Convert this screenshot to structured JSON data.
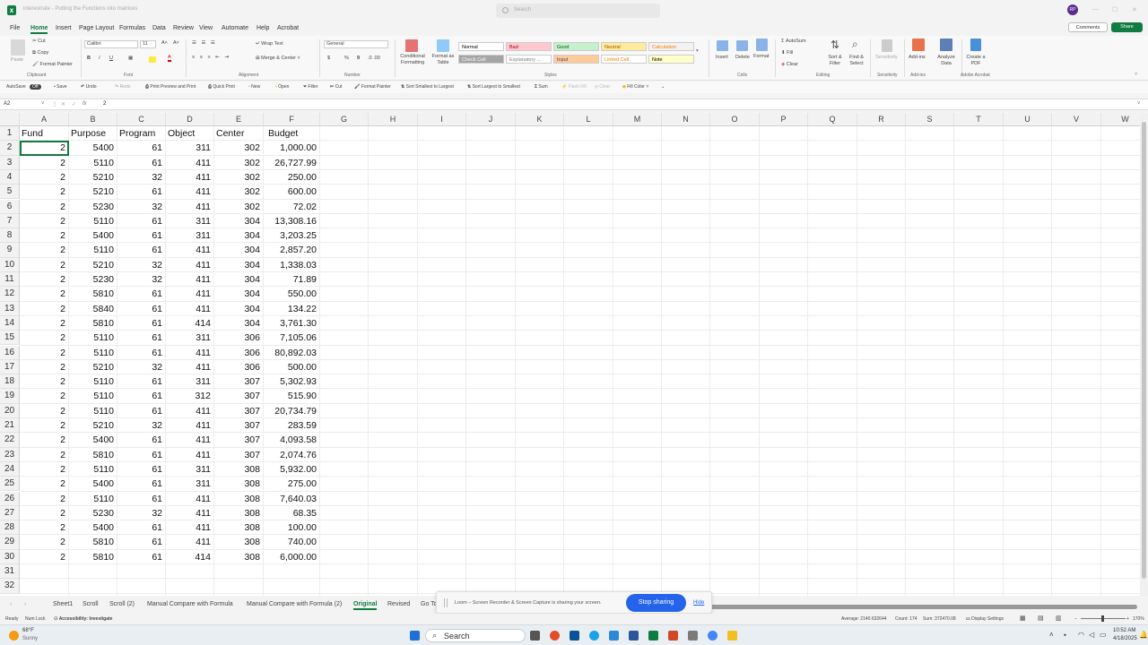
{
  "window": {
    "title": "interestrate - Putting the Functions into matrices",
    "search_placeholder": "Search",
    "avatar_initials": "RP",
    "comments_label": "Comments",
    "share_label": "Share"
  },
  "menu": [
    "File",
    "Home",
    "Insert",
    "Page Layout",
    "Formulas",
    "Data",
    "Review",
    "View",
    "Automate",
    "Help",
    "Acrobat"
  ],
  "menu_active": "Home",
  "ribbon": {
    "clipboard": {
      "paste": "Paste",
      "cut": "Cut",
      "copy": "Copy",
      "format_painter": "Format Painter",
      "group": "Clipboard"
    },
    "font": {
      "name": "Calibri",
      "size": "11",
      "group": "Font",
      "bold": "B",
      "italic": "I",
      "underline": "U"
    },
    "alignment": {
      "wrap": "Wrap Text",
      "merge": "Merge & Center",
      "group": "Alignment"
    },
    "number": {
      "format": "General",
      "group": "Number",
      "currency": "$",
      "percent": "%",
      "comma": "9"
    },
    "styles": {
      "conditional": "Conditional Formatting",
      "format_table": "Format as Table",
      "group": "Styles",
      "items": [
        {
          "label": "Normal",
          "bg": "#ffffff",
          "fg": "#000000"
        },
        {
          "label": "Bad",
          "bg": "#ffc7ce",
          "fg": "#9c0006"
        },
        {
          "label": "Good",
          "bg": "#c6efce",
          "fg": "#006100"
        },
        {
          "label": "Neutral",
          "bg": "#ffeb9c",
          "fg": "#9c5700"
        },
        {
          "label": "Calculation",
          "bg": "#f2f2f2",
          "fg": "#fa7d00"
        },
        {
          "label": "Check Cell",
          "bg": "#a5a5a5",
          "fg": "#ffffff"
        },
        {
          "label": "Explanatory ...",
          "bg": "#ffffff",
          "fg": "#7f7f7f"
        },
        {
          "label": "Input",
          "bg": "#ffcc99",
          "fg": "#3f3f76"
        },
        {
          "label": "Linked Cell",
          "bg": "#ffffff",
          "fg": "#fa7d00"
        },
        {
          "label": "Note",
          "bg": "#ffffcc",
          "fg": "#000000"
        }
      ]
    },
    "cells": {
      "insert": "Insert",
      "delete": "Delete",
      "format": "Format",
      "group": "Cells"
    },
    "editing": {
      "autosum": "AutoSum",
      "fill": "Fill",
      "clear": "Clear",
      "sort": "Sort & Filter",
      "find": "Find & Select",
      "group": "Editing"
    },
    "sensitivity": {
      "label": "Sensitivity",
      "group": "Sensitivity"
    },
    "addins": {
      "label": "Add-ins",
      "group": "Add-ins"
    },
    "analyze": {
      "label": "Analyze Data"
    },
    "pdf": {
      "label": "Create a PDF",
      "group": "Adobe Acrobat"
    }
  },
  "qat": {
    "autosave": "AutoSave",
    "autosave_state": "Off",
    "save": "Save",
    "undo": "Undo",
    "redo": "Redo",
    "print_preview": "Print Preview and Print",
    "quick_print": "Quick Print",
    "new": "New",
    "open": "Open",
    "filter": "Filter",
    "cut": "Cut",
    "format_painter": "Format Painter",
    "sort_asc": "Sort Smallest to Largest",
    "sort_desc": "Sort Largest to Smallest",
    "sum": "Sum",
    "flash_fill": "Flash Fill",
    "clear": "Clear",
    "fill_color": "Fill Color"
  },
  "formula_bar": {
    "name_box": "A2",
    "value": "2"
  },
  "columns": [
    "A",
    "B",
    "C",
    "D",
    "E",
    "F",
    "G",
    "H",
    "I",
    "J",
    "K",
    "L",
    "M",
    "N",
    "O",
    "P",
    "Q",
    "R",
    "S",
    "T",
    "U",
    "V",
    "W"
  ],
  "rows": [
    1,
    2,
    3,
    4,
    5,
    6,
    7,
    8,
    9,
    10,
    11,
    12,
    13,
    14,
    15,
    16,
    17,
    18,
    19,
    20,
    21,
    22,
    23,
    24,
    25,
    26,
    27,
    28,
    29,
    30,
    31,
    32
  ],
  "headers": [
    "Fund",
    "Purpose",
    "Program",
    "Object",
    "Center",
    "Budget"
  ],
  "table": [
    [
      "2",
      "5400",
      "61",
      "311",
      "302",
      "1,000.00"
    ],
    [
      "2",
      "5110",
      "61",
      "411",
      "302",
      "26,727.99"
    ],
    [
      "2",
      "5210",
      "32",
      "411",
      "302",
      "250.00"
    ],
    [
      "2",
      "5210",
      "61",
      "411",
      "302",
      "600.00"
    ],
    [
      "2",
      "5230",
      "32",
      "411",
      "302",
      "72.02"
    ],
    [
      "2",
      "5110",
      "61",
      "311",
      "304",
      "13,308.16"
    ],
    [
      "2",
      "5400",
      "61",
      "311",
      "304",
      "3,203.25"
    ],
    [
      "2",
      "5110",
      "61",
      "411",
      "304",
      "2,857.20"
    ],
    [
      "2",
      "5210",
      "32",
      "411",
      "304",
      "1,338.03"
    ],
    [
      "2",
      "5230",
      "32",
      "411",
      "304",
      "71.89"
    ],
    [
      "2",
      "5810",
      "61",
      "411",
      "304",
      "550.00"
    ],
    [
      "2",
      "5840",
      "61",
      "411",
      "304",
      "134.22"
    ],
    [
      "2",
      "5810",
      "61",
      "414",
      "304",
      "3,761.30"
    ],
    [
      "2",
      "5110",
      "61",
      "311",
      "306",
      "7,105.06"
    ],
    [
      "2",
      "5110",
      "61",
      "411",
      "306",
      "80,892.03"
    ],
    [
      "2",
      "5210",
      "32",
      "411",
      "306",
      "500.00"
    ],
    [
      "2",
      "5110",
      "61",
      "311",
      "307",
      "5,302.93"
    ],
    [
      "2",
      "5110",
      "61",
      "312",
      "307",
      "515.90"
    ],
    [
      "2",
      "5110",
      "61",
      "411",
      "307",
      "20,734.79"
    ],
    [
      "2",
      "5210",
      "32",
      "411",
      "307",
      "283.59"
    ],
    [
      "2",
      "5400",
      "61",
      "411",
      "307",
      "4,093.58"
    ],
    [
      "2",
      "5810",
      "61",
      "411",
      "307",
      "2,074.76"
    ],
    [
      "2",
      "5110",
      "61",
      "311",
      "308",
      "5,932.00"
    ],
    [
      "2",
      "5400",
      "61",
      "311",
      "308",
      "275.00"
    ],
    [
      "2",
      "5110",
      "61",
      "411",
      "308",
      "7,640.03"
    ],
    [
      "2",
      "5230",
      "32",
      "411",
      "308",
      "68.35"
    ],
    [
      "2",
      "5400",
      "61",
      "411",
      "308",
      "100.00"
    ],
    [
      "2",
      "5810",
      "61",
      "411",
      "308",
      "740.00"
    ],
    [
      "2",
      "5810",
      "61",
      "414",
      "308",
      "6,000.00"
    ]
  ],
  "sheets": [
    "Sheet1",
    "Scroll",
    "Scroll (2)",
    "Manual Compare with Formula",
    "Manual Compare with Formula (2)",
    "Original",
    "Revised",
    "Go To"
  ],
  "active_sheet": "Original",
  "loom": {
    "message": "Loom – Screen Recorder & Screen Capture is sharing your screen.",
    "stop": "Stop sharing",
    "hide": "Hide"
  },
  "status": {
    "ready": "Ready",
    "numlock": "Num Lock",
    "accessibility": "Accessibility: Investigate",
    "average": "Average: 2140.632644",
    "count": "Count: 174",
    "sum": "Sum: 372470.08",
    "display": "Display Settings",
    "zoom": "170%"
  },
  "taskbar": {
    "weather_temp": "68°F",
    "weather_desc": "Sunny",
    "search": "Search",
    "time": "10:52 AM",
    "date": "4/18/2025"
  }
}
